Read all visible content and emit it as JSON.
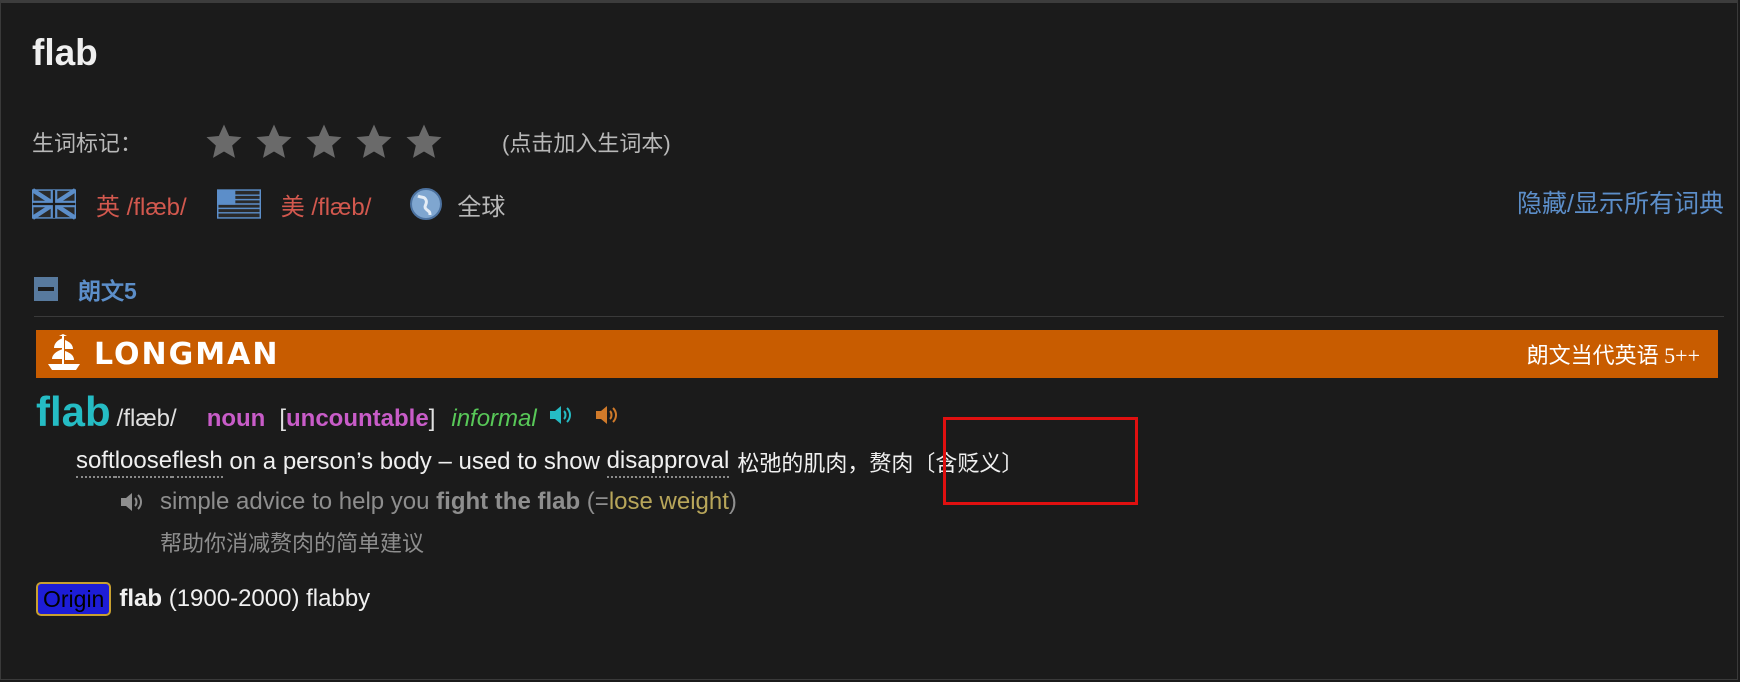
{
  "headword": "flab",
  "mark": {
    "label": "生词标记：",
    "stars_total": 5,
    "stars_filled": 0,
    "hint": "(点击加入生词本)"
  },
  "pronunciation": {
    "uk_label": "英",
    "uk_ipa": "/flæb/",
    "us_label": "美",
    "us_ipa": "/flæb/",
    "global_label": "全球"
  },
  "toggle_all_label": "隐藏/显示所有词典",
  "dictionary": {
    "name": "朗文5",
    "brand": "LONGMAN",
    "edition": "朗文当代英语 5++"
  },
  "entry": {
    "word": "flab",
    "ipa": "/flæb/",
    "pos": "noun",
    "gram_open": "[",
    "gram": "uncountable",
    "gram_close": "]",
    "register": "informal",
    "def_words": [
      "soft",
      "loose",
      "flesh"
    ],
    "def_mid": " on a person’s body – used to show ",
    "def_link": "disapproval",
    "def_cn_a": "松弛的肌肉，",
    "def_cn_b": "赘肉〔含贬义〕",
    "example_pre": "simple advice to help you ",
    "example_bold": "fight the flab",
    "example_paren_open": " (=",
    "example_syn": "lose weight",
    "example_paren_close": ")",
    "example_cn": "帮助你消减赘肉的简单建议"
  },
  "origin": {
    "tag": "Origin",
    "word": "flab",
    "rest": " (1900-2000) flabby"
  },
  "colors": {
    "background": "#1b1b1b",
    "banner": "#c85c00",
    "headword_entry": "#25bcc4",
    "pos": "#c85cc8",
    "register": "#58c858",
    "pron": "#d2584e",
    "link": "#5c8ec9",
    "highlight": "#e01010"
  }
}
